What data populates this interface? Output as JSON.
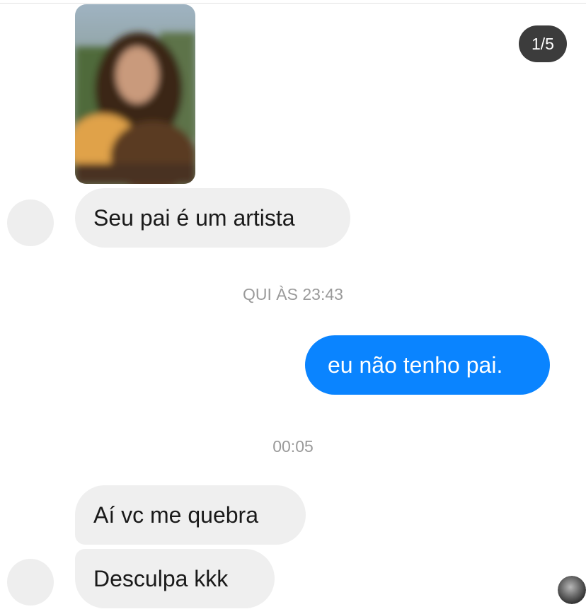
{
  "page_counter": "1/5",
  "messages": [
    {
      "text": "Seu pai é um artista"
    },
    {
      "text": "eu não tenho pai."
    },
    {
      "text": "Aí vc me quebra"
    },
    {
      "text": "Desculpa kkk"
    }
  ],
  "timestamps": [
    "QUI ÀS 23:43",
    "00:05"
  ],
  "colors": {
    "outgoing_bubble": "#0a84ff",
    "incoming_bubble": "#efefef",
    "timestamp_text": "#9a9a9a"
  }
}
